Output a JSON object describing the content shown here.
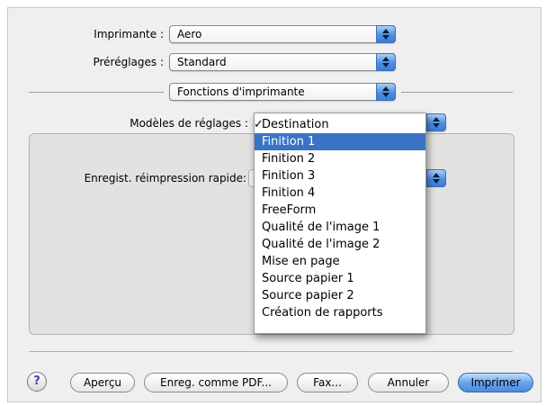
{
  "printer": {
    "label": "Imprimante :",
    "value": "Aero"
  },
  "presets": {
    "label": "Préréglages :",
    "value": "Standard"
  },
  "panel_selector": {
    "value": "Fonctions d'imprimante"
  },
  "settings_models": {
    "label": "Modèles de réglages :",
    "menu": {
      "checked_item": "Destination",
      "highlighted_item": "Finition 1",
      "items": [
        "Destination",
        "Finition 1",
        "Finition 2",
        "Finition 3",
        "Finition 4",
        "FreeForm",
        "Qualité de l'image 1",
        "Qualité de l'image 2",
        "Mise en page",
        "Source papier 1",
        "Source papier 2",
        "Création de rapports"
      ]
    }
  },
  "quick_reprint": {
    "label": "Enregist. réimpression rapide:"
  },
  "buttons": {
    "help": "?",
    "preview": "Aperçu",
    "save_pdf": "Enreg. comme PDF...",
    "fax": "Fax...",
    "cancel": "Annuler",
    "print": "Imprimer"
  },
  "colors": {
    "accent": "#3a72c6"
  }
}
